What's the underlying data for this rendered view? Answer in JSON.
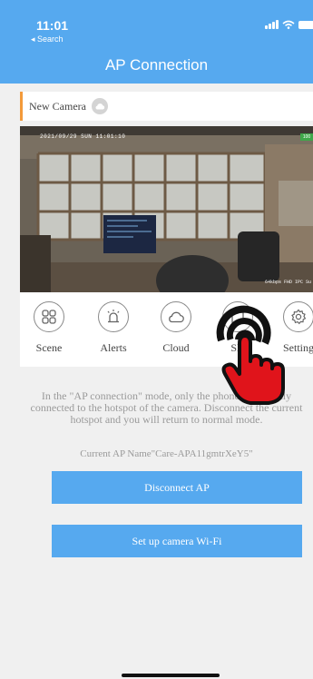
{
  "status_bar": {
    "time": "11:01",
    "back_label": "◂ Search"
  },
  "header": {
    "title": "AP Connection"
  },
  "device": {
    "name": "New Camera"
  },
  "video": {
    "timestamp": "2021/09/29  SUN 11:01:10",
    "bitrate": "64kbps FHD IPC Su",
    "badge": "100"
  },
  "functions": [
    {
      "label": "Scene",
      "icon": "scene-grid-icon"
    },
    {
      "label": "Alerts",
      "icon": "alarm-siren-icon"
    },
    {
      "label": "Cloud",
      "icon": "cloud-icon"
    },
    {
      "label": "SD",
      "icon": "sd-card-icon"
    },
    {
      "label": "Setting",
      "icon": "gear-icon"
    }
  ],
  "content": {
    "info_text": "In the \"AP connection\" mode, only the phone is currently connected to the hotspot of the camera. Disconnect the current hotspot and you will return to normal mode.",
    "ap_name": "Current AP Name\"Care-APA11gmtrXeY5\"",
    "disconnect_label": "Disconnect AP",
    "setup_label": "Set up camera Wi-Fi"
  },
  "colors": {
    "accent": "#56a9ef",
    "device_accent": "#f39a3a",
    "overlay": "#e0141b"
  }
}
